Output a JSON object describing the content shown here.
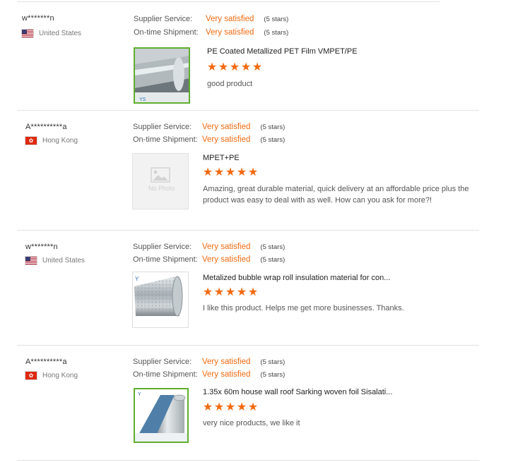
{
  "reviews": [
    {
      "user": "w*******n",
      "country": "United States",
      "flag": "us",
      "supplier_service": {
        "label": "Supplier Service:",
        "value": "Very satisfied",
        "stars_text": "(5 stars)"
      },
      "shipment": {
        "label": "On-time Shipment:",
        "value": "Very satisfied",
        "stars_text": "(5 stars)"
      },
      "product_title": "PE Coated Metallized PET Film VMPET/PE",
      "rating": 5,
      "comment": "good product",
      "image": "film-roll-photo"
    },
    {
      "user": "A**********a",
      "country": "Hong Kong",
      "flag": "hk",
      "supplier_service": {
        "label": "Supplier Service:",
        "value": "Very satisfied",
        "stars_text": "(5 stars)"
      },
      "shipment": {
        "label": "On-time Shipment:",
        "value": "Very satisfied",
        "stars_text": "(5 stars)"
      },
      "product_title": "MPET+PE",
      "rating": 5,
      "comment": "Amazing, great durable material, quick delivery at an affordable price plus the product was easy to deal with as well. How can you ask for more?!",
      "image": "no-photo-placeholder",
      "no_photo_text": "No Photo"
    },
    {
      "user": "w*******n",
      "country": "United States",
      "flag": "us",
      "supplier_service": {
        "label": "Supplier Service:",
        "value": "Very satisfied",
        "stars_text": "(5 stars)"
      },
      "shipment": {
        "label": "On-time Shipment:",
        "value": "Very satisfied",
        "stars_text": "(5 stars)"
      },
      "product_title": "Metalized bubble wrap roll insulation material for con...",
      "rating": 5,
      "comment": "I like this product. Helps me get more businesses. Thanks.",
      "image": "bubble-foil-roll-photo"
    },
    {
      "user": "A**********a",
      "country": "Hong Kong",
      "flag": "hk",
      "supplier_service": {
        "label": "Supplier Service:",
        "value": "Very satisfied",
        "stars_text": "(5 stars)"
      },
      "shipment": {
        "label": "On-time Shipment:",
        "value": "Very satisfied",
        "stars_text": "(5 stars)"
      },
      "product_title": "1.35x 60m house wall roof Sarking woven foil Sisalati...",
      "rating": 5,
      "comment": "very nice products, we like it",
      "image": "woven-foil-roll-photo"
    }
  ],
  "colors": {
    "accent": "#f26a10",
    "divider": "#e3e3e3",
    "label": "#555555"
  }
}
